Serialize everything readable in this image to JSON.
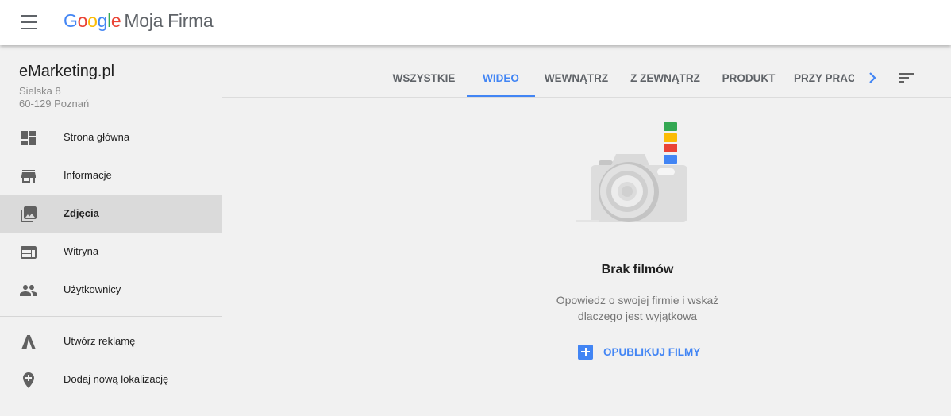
{
  "header": {
    "logo_letters": [
      "G",
      "o",
      "o",
      "g",
      "l",
      "e"
    ],
    "logo_colors": [
      "#4285f4",
      "#ea4335",
      "#fbbc05",
      "#4285f4",
      "#34a853",
      "#ea4335"
    ],
    "product_name": "Moja Firma"
  },
  "business": {
    "name": "eMarketing.pl",
    "address_line1": "Sielska 8",
    "address_line2": "60-129 Poznań"
  },
  "sidebar": {
    "items": [
      {
        "label": "Strona główna",
        "icon": "dashboard-icon"
      },
      {
        "label": "Informacje",
        "icon": "store-icon"
      },
      {
        "label": "Zdjęcia",
        "icon": "photo-library-icon",
        "active": true
      },
      {
        "label": "Witryna",
        "icon": "web-icon"
      },
      {
        "label": "Użytkownicy",
        "icon": "people-icon"
      }
    ],
    "secondary_items": [
      {
        "label": "Utwórz reklamę",
        "icon": "google-ads-icon"
      },
      {
        "label": "Dodaj nową lokalizację",
        "icon": "add-location-icon"
      }
    ]
  },
  "tabs": [
    {
      "label": "WSZYSTKIE"
    },
    {
      "label": "WIDEO",
      "active": true
    },
    {
      "label": "WEWNĄTRZ"
    },
    {
      "label": "Z ZEWNĄTRZ"
    },
    {
      "label": "PRODUKT"
    },
    {
      "label": "PRZY PRACY"
    }
  ],
  "empty_state": {
    "title": "Brak filmów",
    "desc_line1": "Opowiedz o swojej firmie i wskaż",
    "desc_line2": "dlaczego jest wyjątkowa",
    "action_label": "OPUBLIKUJ FILMY"
  },
  "colors": {
    "accent": "#4285f4",
    "active_nav_bg": "#dadada",
    "camera_stripes": [
      "#34a853",
      "#fbbc05",
      "#ea4335",
      "#4285f4"
    ]
  }
}
